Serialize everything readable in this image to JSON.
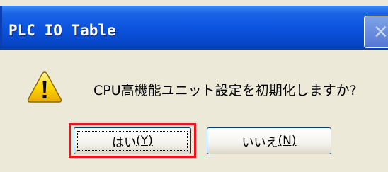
{
  "dialog": {
    "title": "PLC IO Table",
    "close_symbol": "✕",
    "message": "CPU高機能ユニット設定を初期化しますか?",
    "icon": "warning-icon",
    "buttons": {
      "yes_label": "はい",
      "yes_key": "(Y)",
      "no_label": "いいえ",
      "no_key": "(N)"
    }
  },
  "colors": {
    "titlebar": "#0a52dc",
    "body": "#ece9d8",
    "highlight": "#e8151e"
  }
}
